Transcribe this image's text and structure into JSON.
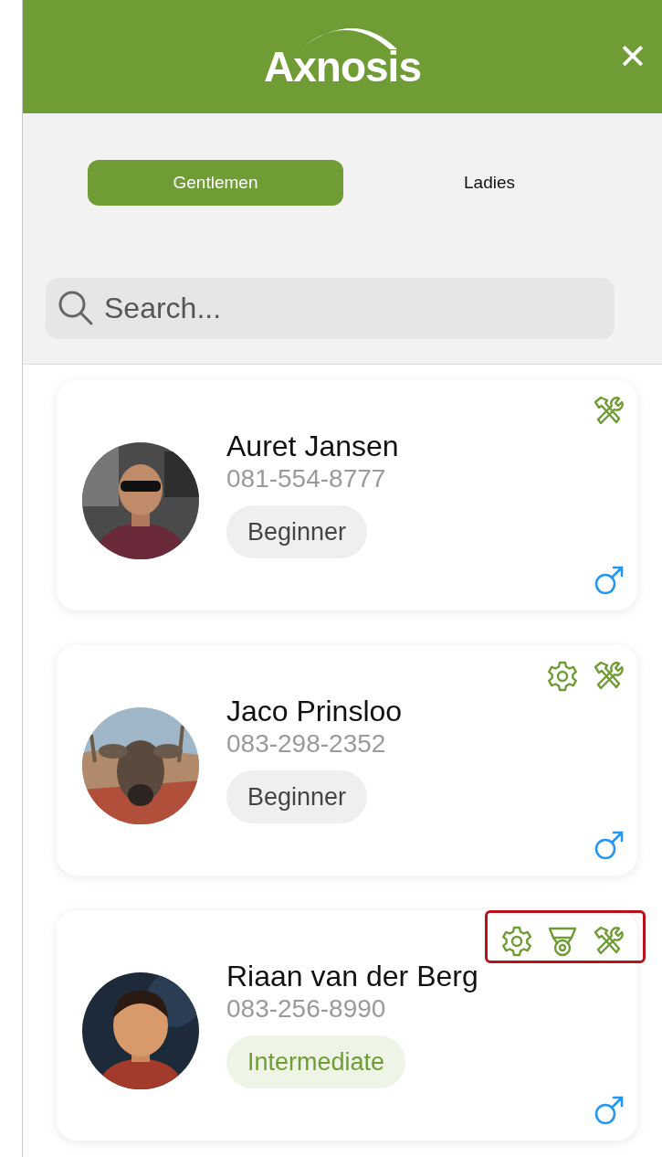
{
  "header": {
    "logo": "Axnosis",
    "close": "✕"
  },
  "tabs": [
    {
      "label": "Gentlemen",
      "selected": true
    },
    {
      "label": "Ladies",
      "selected": false
    }
  ],
  "search": {
    "placeholder": "Search..."
  },
  "people": [
    {
      "name": "Auret Jansen",
      "phone": "081-554-8777",
      "skill": {
        "label": "Beginner",
        "kind": "beginner"
      },
      "badges": [
        {
          "kind": "tools"
        }
      ],
      "gender": {
        "kind": "male"
      },
      "highlighted": false,
      "avatar": {
        "kind": "picture"
      }
    },
    {
      "name": "Jaco Prinsloo",
      "phone": "083-298-2352",
      "skill": {
        "label": "Beginner",
        "kind": "beginner"
      },
      "badges": [
        {
          "kind": "gear"
        },
        {
          "kind": "tools"
        }
      ],
      "gender": {
        "kind": "male"
      },
      "highlighted": false,
      "avatar": {
        "kind": "picture"
      }
    },
    {
      "name": "Riaan van der Berg",
      "phone": "083-256-8990",
      "skill": {
        "label": "Intermediate",
        "kind": "intermediate"
      },
      "badges": [
        {
          "kind": "gear"
        },
        {
          "kind": "medal"
        },
        {
          "kind": "tools"
        }
      ],
      "gender": {
        "kind": "male"
      },
      "highlighted": true,
      "avatar": {
        "kind": "picture"
      }
    }
  ]
}
